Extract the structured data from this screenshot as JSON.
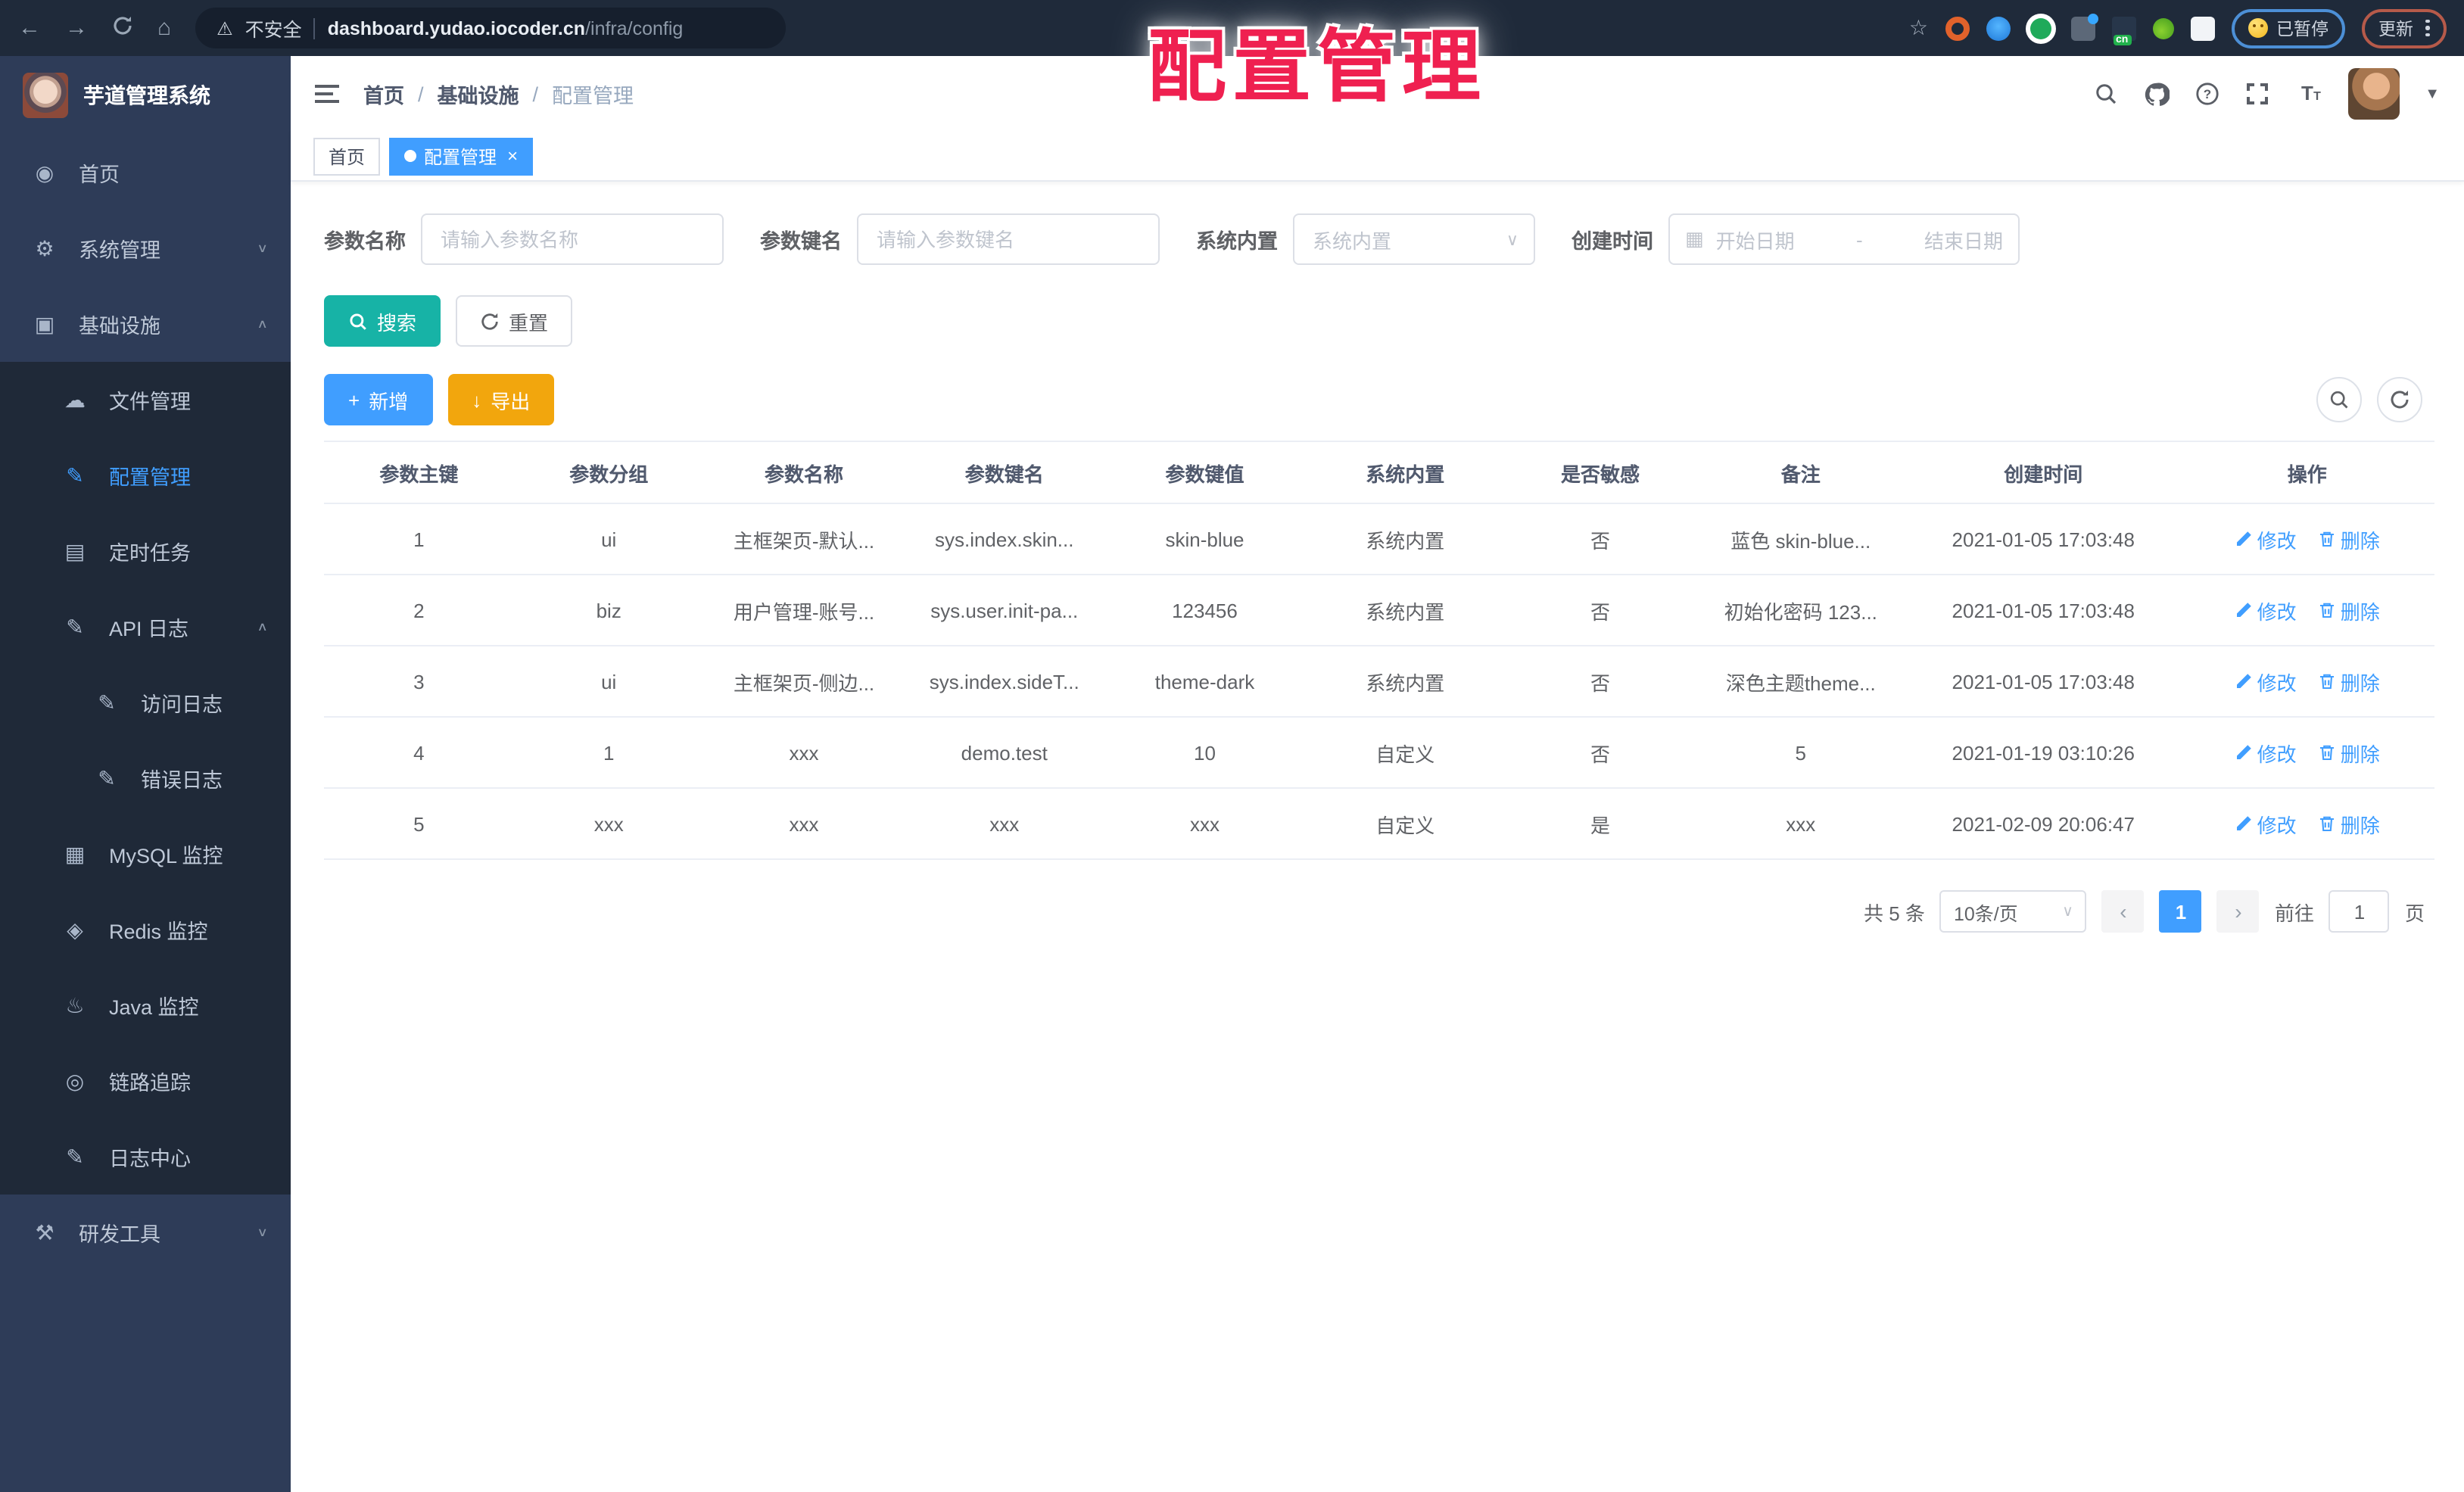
{
  "colors": {
    "primary": "#409eff",
    "teal": "#17b3a6",
    "orange": "#f2a60d",
    "sidebar_bg": "#2e3c58",
    "submenu_bg": "#1f2938",
    "overlay_red": "#ef2050"
  },
  "overlay": {
    "title": "配置管理"
  },
  "browser": {
    "security_label": "不安全",
    "url_host": "dashboard.yudao.iocoder.cn",
    "url_path": "/infra/config",
    "paused_label": "已暂停",
    "update_label": "更新"
  },
  "sidebar": {
    "app_title": "芋道管理系统",
    "items": [
      {
        "name": "home",
        "label": "首页",
        "icon": "dashboard",
        "level": 1
      },
      {
        "name": "system-mgmt",
        "label": "系统管理",
        "icon": "gear",
        "level": 1,
        "chevron": "down"
      },
      {
        "name": "infrastructure",
        "label": "基础设施",
        "icon": "monitor",
        "level": 1,
        "chevron": "up"
      },
      {
        "name": "file-mgmt",
        "label": "文件管理",
        "icon": "cloud",
        "level": 2,
        "sub": true
      },
      {
        "name": "config-mgmt",
        "label": "配置管理",
        "icon": "edit",
        "level": 2,
        "sub": true,
        "active": true
      },
      {
        "name": "scheduled-jobs",
        "label": "定时任务",
        "icon": "schedule",
        "level": 2,
        "sub": true
      },
      {
        "name": "api-logs",
        "label": "API 日志",
        "icon": "form",
        "level": 2,
        "sub": true,
        "chevron": "up"
      },
      {
        "name": "access-logs",
        "label": "访问日志",
        "icon": "edit",
        "level": 3,
        "sub": true
      },
      {
        "name": "error-logs",
        "label": "错误日志",
        "icon": "edit",
        "level": 3,
        "sub": true
      },
      {
        "name": "mysql-monitor",
        "label": "MySQL 监控",
        "icon": "mysql",
        "level": 2,
        "sub": true
      },
      {
        "name": "redis-monitor",
        "label": "Redis 监控",
        "icon": "redis",
        "level": 2,
        "sub": true
      },
      {
        "name": "java-monitor",
        "label": "Java 监控",
        "icon": "java",
        "level": 2,
        "sub": true
      },
      {
        "name": "tracing",
        "label": "链路追踪",
        "icon": "eye",
        "level": 2,
        "sub": true
      },
      {
        "name": "log-center",
        "label": "日志中心",
        "icon": "log",
        "level": 2,
        "sub": true
      },
      {
        "name": "dev-tools",
        "label": "研发工具",
        "icon": "tool",
        "level": 1,
        "chevron": "down"
      }
    ]
  },
  "breadcrumb": {
    "items": [
      "首页",
      "基础设施",
      "配置管理"
    ]
  },
  "tabs": [
    {
      "label": "首页",
      "active": false,
      "closable": false
    },
    {
      "label": "配置管理",
      "active": true,
      "closable": true
    }
  ],
  "filters": {
    "name_label": "参数名称",
    "name_placeholder": "请输入参数名称",
    "key_label": "参数键名",
    "key_placeholder": "请输入参数键名",
    "type_label": "系统内置",
    "type_placeholder": "系统内置",
    "date_label": "创建时间",
    "date_start": "开始日期",
    "date_separator": "-",
    "date_end": "结束日期"
  },
  "actions": {
    "search": "搜索",
    "reset": "重置",
    "add": "新增",
    "export": "导出"
  },
  "table": {
    "headers": [
      "参数主键",
      "参数分组",
      "参数名称",
      "参数键名",
      "参数键值",
      "系统内置",
      "是否敏感",
      "备注",
      "创建时间",
      "操作"
    ],
    "rows": [
      [
        "1",
        "ui",
        "主框架页-默认...",
        "sys.index.skin...",
        "skin-blue",
        "系统内置",
        "否",
        "蓝色 skin-blue...",
        "2021-01-05 17:03:48"
      ],
      [
        "2",
        "biz",
        "用户管理-账号...",
        "sys.user.init-pa...",
        "123456",
        "系统内置",
        "否",
        "初始化密码 123...",
        "2021-01-05 17:03:48"
      ],
      [
        "3",
        "ui",
        "主框架页-侧边...",
        "sys.index.sideT...",
        "theme-dark",
        "系统内置",
        "否",
        "深色主题theme...",
        "2021-01-05 17:03:48"
      ],
      [
        "4",
        "1",
        "xxx",
        "demo.test",
        "10",
        "自定义",
        "否",
        "5",
        "2021-01-19 03:10:26"
      ],
      [
        "5",
        "xxx",
        "xxx",
        "xxx",
        "xxx",
        "自定义",
        "是",
        "xxx",
        "2021-02-09 20:06:47"
      ]
    ],
    "edit_label": "修改",
    "delete_label": "删除"
  },
  "pagination": {
    "total": "共 5 条",
    "page_size": "10条/页",
    "current_page": "1",
    "goto_label": "前往",
    "goto_value": "1",
    "page_unit": "页"
  }
}
